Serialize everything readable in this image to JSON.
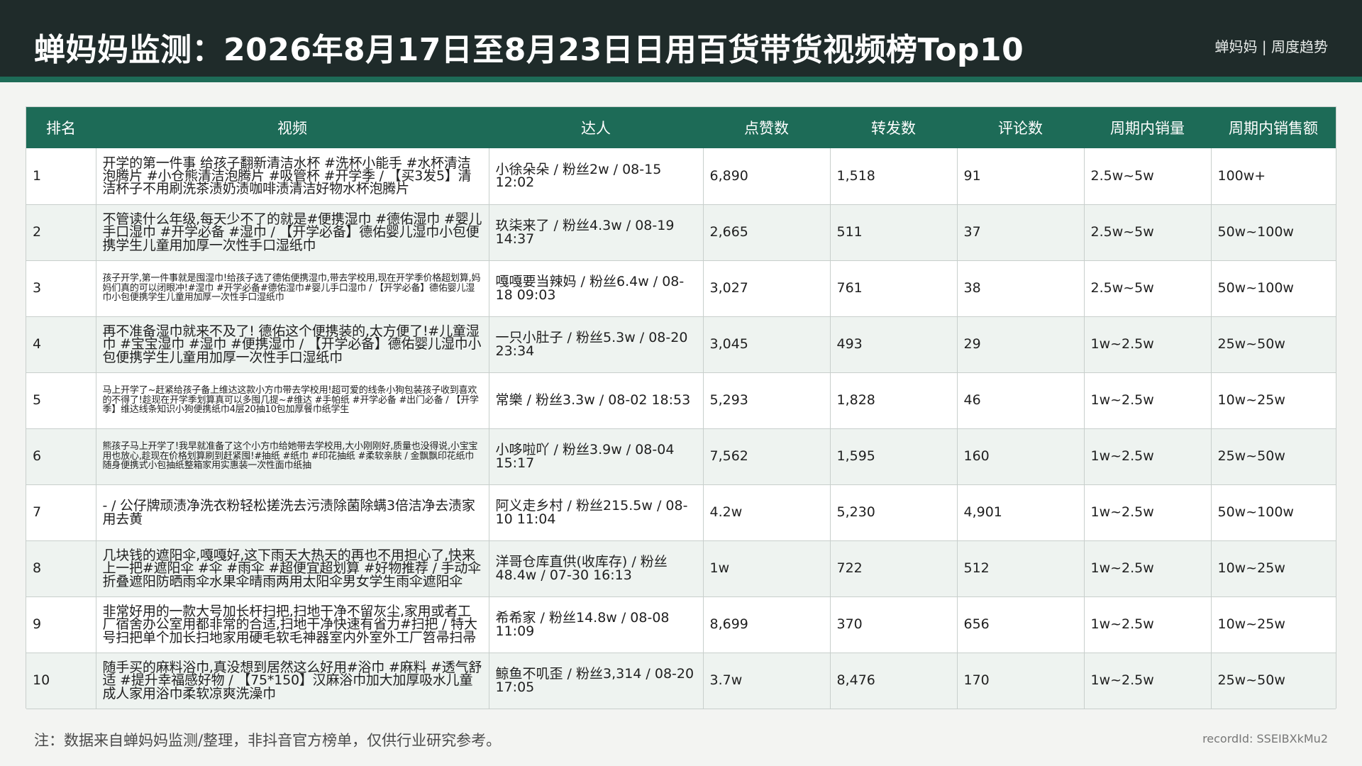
{
  "header": {
    "title": "蝉妈妈监测：2026年8月17日至8月23日日用百货带货视频榜Top10",
    "right": "蝉妈妈 | 周度趋势"
  },
  "table": {
    "columns": [
      "排名",
      "视频",
      "达人",
      "点赞数",
      "转发数",
      "评论数",
      "周期内销量",
      "周期内销售额"
    ],
    "rows": [
      {
        "rank": "1",
        "video": "开学的第一件事 给孩子翻新清洁水杯 #洗杯小能手 #水杯清洁泡腾片 #小仓熊清洁泡腾片 #吸管杯 #开学季 / 【买3发5】清洁杯子不用刷洗茶渍奶渍咖啡渍清洁好物水杯泡腾片",
        "author": "小徐朵朵 / 粉丝2w / 08-15 12:02",
        "likes": "6,890",
        "shares": "1,518",
        "comments": "91",
        "sales": "2.5w~5w",
        "gmv": "100w+"
      },
      {
        "rank": "2",
        "video": "不管读什么年级,每天少不了的就是#便携湿巾 #德佑湿巾 #婴儿手口湿巾 #开学必备 #湿巾 / 【开学必备】德佑婴儿湿巾小包便携学生儿童用加厚一次性手口湿纸巾",
        "author": "玖柒来了 / 粉丝4.3w / 08-19 14:37",
        "likes": "2,665",
        "shares": "511",
        "comments": "37",
        "sales": "2.5w~5w",
        "gmv": "50w~100w"
      },
      {
        "rank": "3",
        "video": "孩子开学,第一件事就是囤湿巾!给孩子选了德佑便携湿巾,带去学校用,现在开学季价格超划算,妈妈们真的可以闭眼冲!#湿巾 #开学必备#德佑湿巾#婴儿手口湿巾 / 【开学必备】德佑婴儿湿巾小包便携学生儿童用加厚一次性手口湿纸巾",
        "author": "嘎嘎要当辣妈 / 粉丝6.4w / 08-18 09:03",
        "likes": "3,027",
        "shares": "761",
        "comments": "38",
        "sales": "2.5w~5w",
        "gmv": "50w~100w"
      },
      {
        "rank": "4",
        "video": "再不准备湿巾就来不及了! 德佑这个便携装的,太方便了!#儿童湿巾 #宝宝湿巾 #湿巾 #便携湿巾 / 【开学必备】德佑婴儿湿巾小包便携学生儿童用加厚一次性手口湿纸巾",
        "author": "一只小肚子 / 粉丝5.3w / 08-20 23:34",
        "likes": "3,045",
        "shares": "493",
        "comments": "29",
        "sales": "1w~2.5w",
        "gmv": "25w~50w"
      },
      {
        "rank": "5",
        "video": "马上开学了~赶紧给孩子备上维达这款小方巾带去学校用!超可爱的线条小狗包装孩子收到喜欢的不得了!趁现在开学季划算真可以多囤几提~#维达 #手帕纸 #开学必备 #出门必备 / 【开学季】维达线条知识小狗便携纸巾4层20抽10包加厚餐巾纸学生",
        "author": "常樂 / 粉丝3.3w / 08-02 18:53",
        "likes": "5,293",
        "shares": "1,828",
        "comments": "46",
        "sales": "1w~2.5w",
        "gmv": "10w~25w"
      },
      {
        "rank": "6",
        "video": "熊孩子马上开学了!我早就准备了这个小方巾给她带去学校用,大小刚刚好,质量也没得说,小宝宝用也放心,趁现在价格划算刷到赶紧囤!#抽纸 #纸巾 #印花抽纸 #柔软亲肤 / 金飘飘印花纸巾随身便携式小包抽纸整箱家用实惠装一次性面巾纸抽",
        "author": "小哆啦吖 / 粉丝3.9w / 08-04 15:17",
        "likes": "7,562",
        "shares": "1,595",
        "comments": "160",
        "sales": "1w~2.5w",
        "gmv": "25w~50w"
      },
      {
        "rank": "7",
        "video": "- / 公仔牌顽渍净洗衣粉轻松搓洗去污渍除菌除螨3倍洁净去渍家用去黄",
        "author": "阿义走乡村 / 粉丝215.5w / 08-10 11:04",
        "likes": "4.2w",
        "shares": "5,230",
        "comments": "4,901",
        "sales": "1w~2.5w",
        "gmv": "50w~100w"
      },
      {
        "rank": "8",
        "video": "几块钱的遮阳伞,嘎嘎好,这下雨天大热天的再也不用担心了,快来上一把#遮阳伞 #伞 #雨伞 #超便宜超划算 #好物推荐 / 手动伞折叠遮阳防晒雨伞水果伞晴雨两用太阳伞男女学生雨伞遮阳伞",
        "author": "洋哥仓库直供(收库存) / 粉丝48.4w / 07-30 16:13",
        "likes": "1w",
        "shares": "722",
        "comments": "512",
        "sales": "1w~2.5w",
        "gmv": "10w~25w"
      },
      {
        "rank": "9",
        "video": "非常好用的一款大号加长杆扫把,扫地干净不留灰尘,家用或者工厂宿舍办公室用都非常的合适,扫地干净快速有省力#扫把 / 特大号扫把单个加长扫地家用硬毛软毛神器室内外室外工厂笤帚扫帚",
        "author": "希希家 / 粉丝14.8w / 08-08 11:09",
        "likes": "8,699",
        "shares": "370",
        "comments": "656",
        "sales": "1w~2.5w",
        "gmv": "10w~25w"
      },
      {
        "rank": "10",
        "video": "随手买的麻料浴巾,真没想到居然这么好用#浴巾 #麻料 #透气舒适 #提升幸福感好物 / 【75*150】汉麻浴巾加大加厚吸水儿童成人家用浴巾柔软凉爽洗澡巾",
        "author": "鲸鱼不叽歪 / 粉丝3,314 / 08-20 17:05",
        "likes": "3.7w",
        "shares": "8,476",
        "comments": "170",
        "sales": "1w~2.5w",
        "gmv": "25w~50w"
      }
    ]
  },
  "footer": {
    "note": "注：数据来自蝉妈妈监测/整理，非抖音官方榜单，仅供行业研究参考。",
    "record_id": "recordId: SSEIBXkMu2"
  },
  "colors": {
    "header_bg": "#1f2b2a",
    "accent": "#1d6b57",
    "row_alt": "#eef3f0"
  }
}
